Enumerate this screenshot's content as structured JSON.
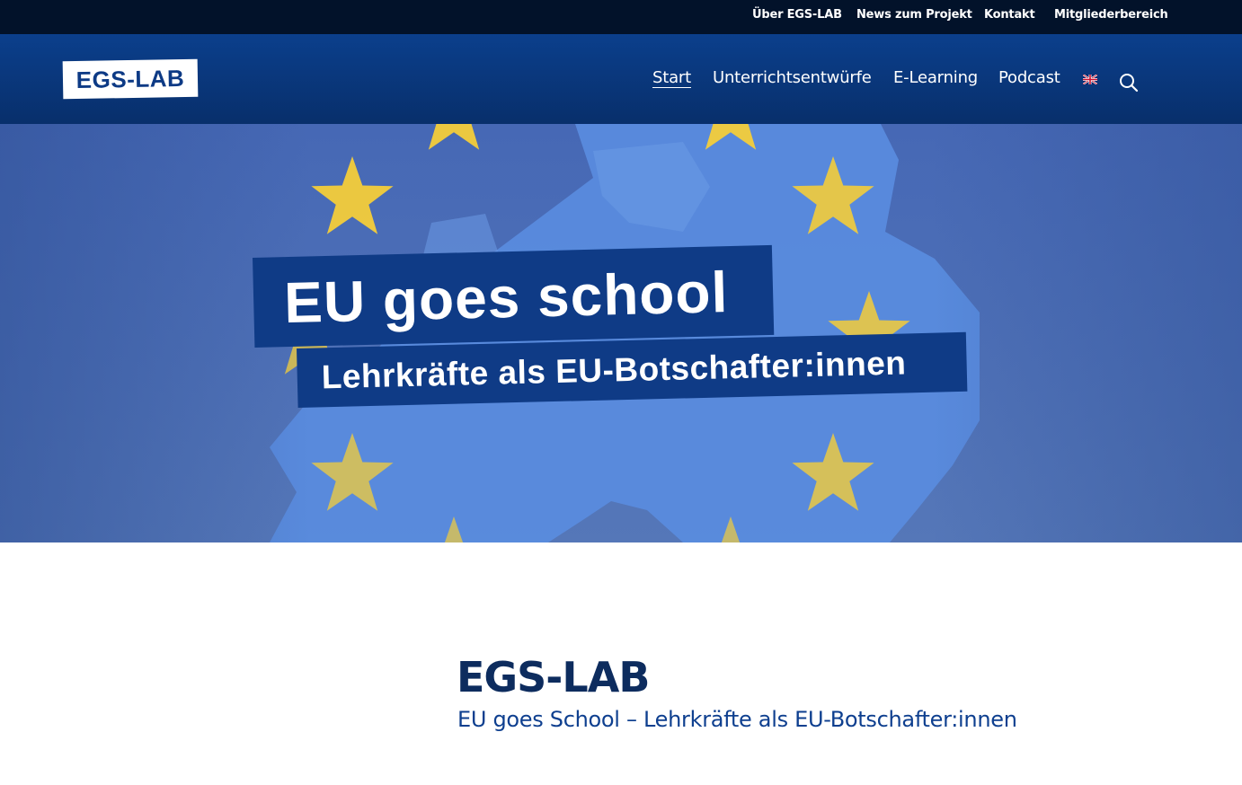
{
  "topbar": {
    "links": [
      "Über EGS-LAB",
      "News zum Projekt",
      "Kontakt",
      "Mitgliederbereich"
    ]
  },
  "header": {
    "logo_text": "EGS-LAB",
    "nav": [
      "Start",
      "Unterrichtsentwürfe",
      "E-Learning",
      "Podcast"
    ],
    "active_nav": "Start",
    "language_icon": "uk-flag-icon",
    "search_icon": "search-icon"
  },
  "hero": {
    "headline": "EU goes school",
    "tagline": "Lehrkräfte als EU-Botschafter:innen"
  },
  "main": {
    "title": "EGS-LAB",
    "subtitle": "EU goes School – Lehrkräfte als EU-Botschafter:innen"
  },
  "colors": {
    "topbar": "#02122a",
    "header": "#0b3f8c",
    "hero_blue": "#4a6ab3",
    "star_yellow": "#f4cd3a",
    "banner": "#0f3b86",
    "title": "#0d2c5e",
    "subtitle": "#0e3f8f"
  }
}
